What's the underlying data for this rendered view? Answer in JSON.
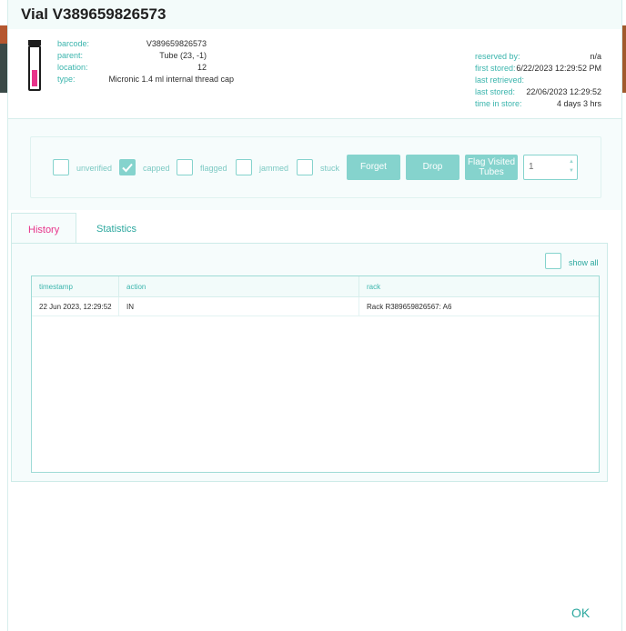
{
  "dialog": {
    "title": "Vial V389659826573"
  },
  "vial_info": {
    "left": [
      {
        "key": "barcode:",
        "value": "V389659826573"
      },
      {
        "key": "parent:",
        "value": "Tube (23, -1)"
      },
      {
        "key": "location:",
        "value": "12"
      },
      {
        "key": "type:",
        "value": "Micronic 1.4 ml internal thread cap"
      }
    ],
    "right": [
      {
        "key": "reserved by:",
        "value": "n/a"
      },
      {
        "key": "first stored:",
        "value": "6/22/2023 12:29:52 PM"
      },
      {
        "key": "last retrieved:",
        "value": ""
      },
      {
        "key": "last stored:",
        "value": "22/06/2023 12:29:52"
      },
      {
        "key": "time in store:",
        "value": "4 days 3 hrs"
      }
    ],
    "vial_fill_color": "#e8338a"
  },
  "flags": [
    {
      "label": "unverified",
      "checked": false
    },
    {
      "label": "capped",
      "checked": true
    },
    {
      "label": "flagged",
      "checked": false
    },
    {
      "label": "jammed",
      "checked": false
    },
    {
      "label": "stuck",
      "checked": false
    }
  ],
  "actions": {
    "forget_label": "Forget",
    "drop_label": "Drop",
    "flag_visited_line1": "Flag Visited",
    "flag_visited_line2": "Tubes",
    "count_value": "1"
  },
  "tabs": [
    {
      "label": "History",
      "active": true
    },
    {
      "label": "Statistics",
      "active": false
    }
  ],
  "history": {
    "show_all_label": "show all",
    "columns": [
      "timestamp",
      "action",
      "rack"
    ],
    "rows": [
      {
        "timestamp": "22 Jun 2023, 12:29:52",
        "action": "IN",
        "rack": "Rack R389659826567: A6"
      }
    ]
  },
  "footer": {
    "ok_label": "OK"
  },
  "colors": {
    "accent": "#85d3cd",
    "accent_text": "#3bb5ad",
    "active_tab": "#e8338a"
  }
}
